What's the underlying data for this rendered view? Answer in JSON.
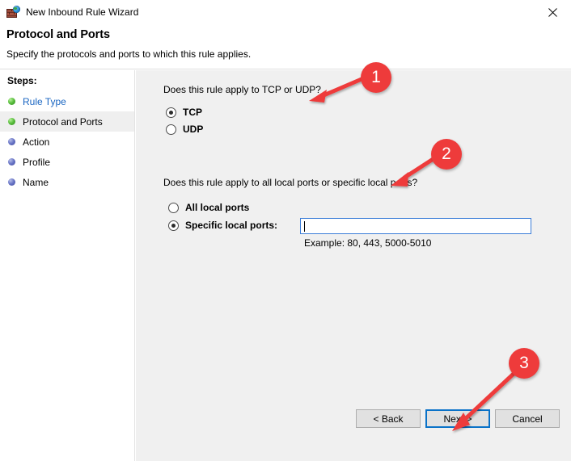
{
  "window": {
    "title": "New Inbound Rule Wizard",
    "icon": "firewall-brick-globe-icon",
    "close_label": "✕"
  },
  "header": {
    "title": "Protocol and Ports",
    "subtitle": "Specify the protocols and ports to which this rule applies."
  },
  "sidebar": {
    "heading": "Steps:",
    "items": [
      {
        "label": "Rule Type",
        "bullet": "green",
        "state": "completed-link"
      },
      {
        "label": "Protocol and Ports",
        "bullet": "green",
        "state": "current"
      },
      {
        "label": "Action",
        "bullet": "blue",
        "state": "pending"
      },
      {
        "label": "Profile",
        "bullet": "blue",
        "state": "pending"
      },
      {
        "label": "Name",
        "bullet": "blue",
        "state": "pending"
      }
    ]
  },
  "main": {
    "question_protocol": "Does this rule apply to TCP or UDP?",
    "protocol_options": [
      {
        "label": "TCP",
        "selected": true
      },
      {
        "label": "UDP",
        "selected": false
      }
    ],
    "question_ports": "Does this rule apply to all local ports or specific local ports?",
    "port_options": [
      {
        "label": "All local ports",
        "selected": false
      },
      {
        "label": "Specific local ports:",
        "selected": true
      }
    ],
    "port_input": {
      "value": "",
      "placeholder": ""
    },
    "example_hint": "Example: 80, 443, 5000-5010"
  },
  "footer": {
    "back_label": "< Back",
    "next_label": "Next >",
    "cancel_label": "Cancel"
  },
  "annotations": [
    {
      "number": "1",
      "target": "question-protocol"
    },
    {
      "number": "2",
      "target": "question-ports"
    },
    {
      "number": "3",
      "target": "next-button"
    }
  ],
  "colors": {
    "accent_red": "#ee3b3b",
    "focus_blue": "#0a72c8",
    "link_blue": "#1a66c2",
    "panel_gray": "#f0f0f0"
  }
}
